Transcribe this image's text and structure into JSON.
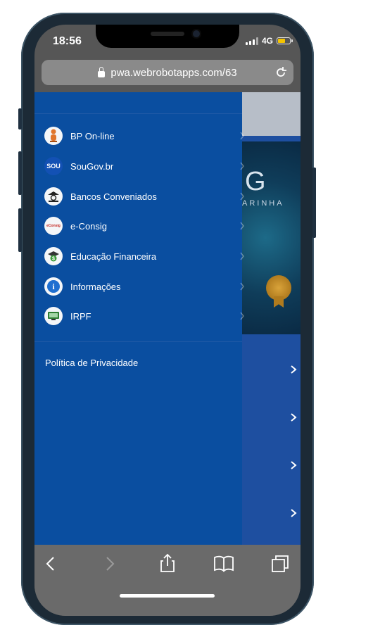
{
  "status_bar": {
    "time": "18:56",
    "network": "4G"
  },
  "browser": {
    "url": "pwa.webrobotapps.com/63"
  },
  "background_page": {
    "banner_letter": "G",
    "banner_text": "ARINHA"
  },
  "drawer": {
    "items": [
      {
        "label": "BP On-line",
        "icon": "bp-mascot-icon"
      },
      {
        "label": "SouGov.br",
        "icon": "sougov-icon",
        "icon_text": "SOU"
      },
      {
        "label": "Bancos Conveniados",
        "icon": "bank-icon"
      },
      {
        "label": "e-Consig",
        "icon": "econsig-icon",
        "icon_text": "eConsig"
      },
      {
        "label": "Educação Financeira",
        "icon": "finance-education-icon"
      },
      {
        "label": "Informações",
        "icon": "info-icon",
        "icon_text": "i"
      },
      {
        "label": "IRPF",
        "icon": "irpf-icon"
      }
    ],
    "privacy_label": "Política de Privacidade"
  },
  "toolbar": {
    "icons": [
      "back-icon",
      "forward-icon",
      "share-icon",
      "bookmarks-icon",
      "tabs-icon"
    ]
  },
  "colors": {
    "drawer_bg": "#0a4ea0",
    "page_bg": "#1e4fa0",
    "battery": "#f5c400"
  }
}
